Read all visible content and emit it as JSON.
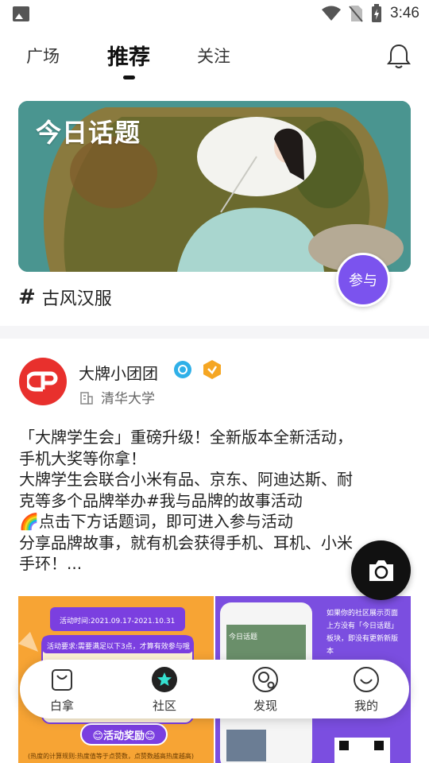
{
  "status_bar": {
    "time": "3:46"
  },
  "tabs": [
    {
      "label": "广场"
    },
    {
      "label": "推荐"
    },
    {
      "label": "关注"
    }
  ],
  "banner": {
    "title": "今日话题",
    "join_label": "参与",
    "topic": "古风汉服"
  },
  "post": {
    "author": "大牌小团团",
    "school": "清华大学",
    "lines": [
      "「大牌学生会」重磅升级！全新版本全新活动，",
      "手机大奖等你拿！",
      "大牌学生会联合小米有品、京东、阿迪达斯、耐",
      "克等多个品牌举办#我与品牌的故事活动",
      "🌈点击下方话题词，即可进入参与活动",
      "分享品牌故事，就有机会获得手机、耳机、小米",
      "手环！..."
    ],
    "image_left": {
      "line1": "活动时间:2021.09.17-2021.10.31",
      "line2": "活动要求:需要满足以下3点，才算有效参与哦",
      "reward": "😊活动奖励😊",
      "footnote": "(热度的计算规则:热度值等于点赞数，点赞数越高热度越高)"
    },
    "image_right": {
      "line1": "如果你的社区展示页面",
      "line2": "上方没有「今日话题」",
      "line3": "板块，即没有更新新版",
      "line4": "本",
      "screen_title": "今日话题"
    }
  },
  "bottom_nav": [
    {
      "label": "白拿",
      "icon": "bag-icon"
    },
    {
      "label": "社区",
      "icon": "star-icon"
    },
    {
      "label": "发现",
      "icon": "discover-icon"
    },
    {
      "label": "我的",
      "icon": "smile-icon"
    }
  ],
  "colors": {
    "accent": "#7b53ee",
    "brand_red": "#e8302d"
  }
}
